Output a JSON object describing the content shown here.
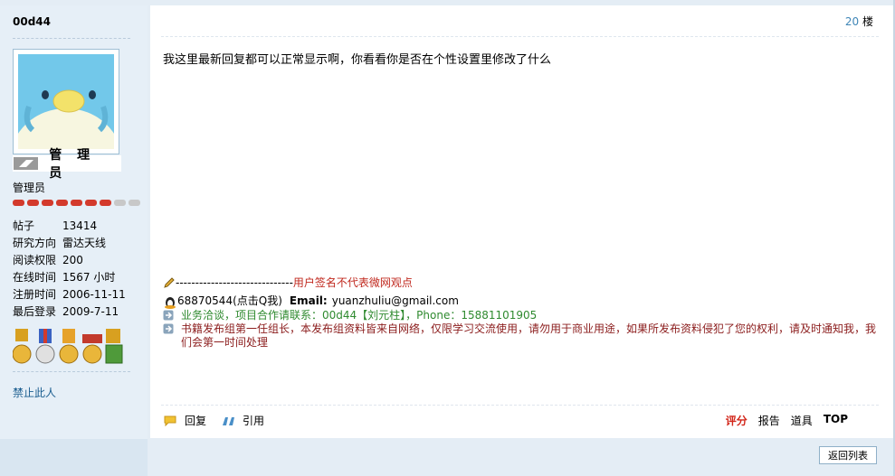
{
  "post": {
    "username": "00d44",
    "floor_number": "20",
    "floor_suffix": "楼",
    "avatar_title": "管 理 员",
    "group": "管理员",
    "stars_filled": 7,
    "stars_total": 9,
    "stats": [
      {
        "label": "帖子",
        "value": "13414"
      },
      {
        "label": "研究方向",
        "value": "雷达天线"
      },
      {
        "label": "阅读权限",
        "value": "200"
      },
      {
        "label": "在线时间",
        "value": "1567 小时"
      },
      {
        "label": "注册时间",
        "value": "2006-11-11"
      },
      {
        "label": "最后登录",
        "value": "2009-7-11"
      }
    ],
    "ban_label": "禁止此人",
    "message": "我这里最新回复都可以正常显示啊，你看看你是否在个性设置里修改了什么"
  },
  "signature": {
    "separator": "------------------------------",
    "disclaimer": "用户签名不代表微网观点",
    "qq": "68870544",
    "qq_hint": "(点击Q我)",
    "email_label": "Email:",
    "email": "yuanzhuliu@gmail.com",
    "business": "业务洽谈，项目合作请联系：00d44【刘元柱】，Phone：15881101905",
    "notice": "书籍发布组第一任组长，本发布组资料皆来自网络，仅限学习交流使用，请勿用于商业用途，如果所发布资料侵犯了您的权利，请及时通知我，我们会第一时间处理"
  },
  "actions": {
    "reply": "回复",
    "quote": "引用",
    "rate": "评分",
    "report": "报告",
    "props": "道具",
    "top": "TOP",
    "back_list": "返回列表"
  },
  "colors": {
    "star_filled": "#d33a2c",
    "star_empty": "#c8c8c8",
    "floor_number": "#3f86b7"
  }
}
